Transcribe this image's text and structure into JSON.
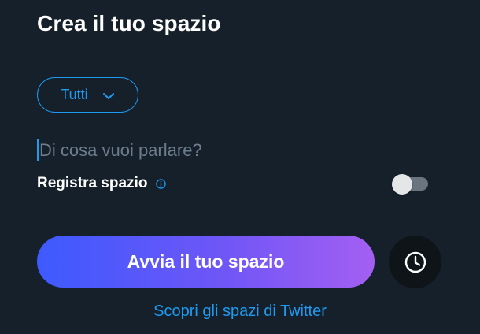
{
  "header": {
    "title": "Crea il tuo spazio"
  },
  "audience": {
    "selected": "Tutti",
    "icon": "chevron-down-icon"
  },
  "topic": {
    "value": "",
    "placeholder": "Di cosa vuoi parlare?"
  },
  "record": {
    "label": "Registra spazio",
    "info_icon": "info-icon",
    "enabled": false
  },
  "actions": {
    "start_label": "Avvia il tuo spazio",
    "schedule_icon": "clock-icon",
    "discover_link": "Scopri gli spazi di Twitter"
  },
  "colors": {
    "background": "#15202b",
    "accent": "#1d9bf0",
    "gradient_start": "#3d5afe",
    "gradient_end": "#a45ff2"
  }
}
